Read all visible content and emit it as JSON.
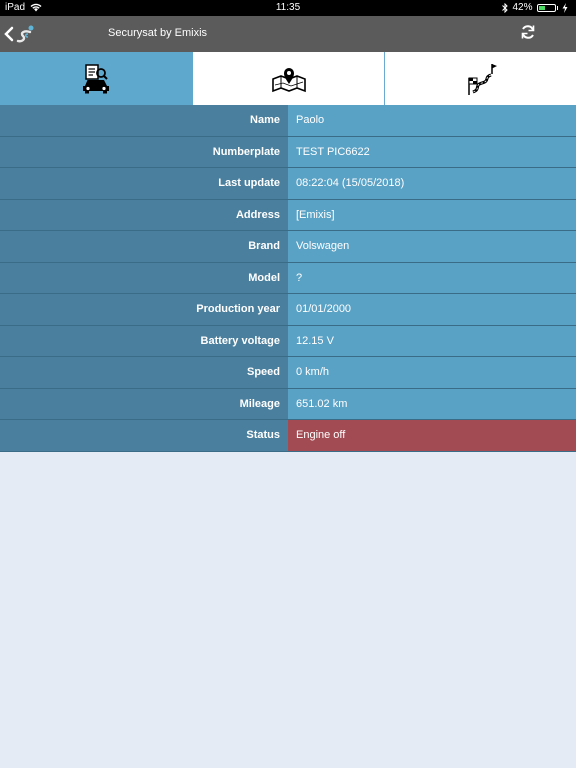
{
  "status_bar": {
    "device": "iPad",
    "time": "11:35",
    "battery_percent": "42%",
    "battery_level": 0.42,
    "icons": [
      "wifi-icon",
      "bluetooth-icon",
      "battery-icon",
      "charging-icon"
    ]
  },
  "nav": {
    "title": "Securysat by Emixis",
    "icons": [
      "back-chevron-icon",
      "app-logo-icon",
      "refresh-icon"
    ]
  },
  "tabs": [
    {
      "name": "vehicle-info",
      "icon": "car-document-icon",
      "active": true
    },
    {
      "name": "map",
      "icon": "map-pin-icon",
      "active": false
    },
    {
      "name": "route",
      "icon": "route-flag-icon",
      "active": false
    }
  ],
  "details": {
    "rows": [
      {
        "label": "Name",
        "value": "Paolo"
      },
      {
        "label": "Numberplate",
        "value": "TEST PIC6622"
      },
      {
        "label": "Last update",
        "value": "08:22:04 (15/05/2018)"
      },
      {
        "label": "Address",
        "value": "[Emixis]"
      },
      {
        "label": "Brand",
        "value": "Volswagen"
      },
      {
        "label": "Model",
        "value": "?"
      },
      {
        "label": "Production year",
        "value": "01/01/2000"
      },
      {
        "label": "Battery voltage",
        "value": "12.15 V"
      },
      {
        "label": "Speed",
        "value": "0 km/h"
      },
      {
        "label": "Mileage",
        "value": "651.02 km"
      },
      {
        "label": "Status",
        "value": "Engine off"
      }
    ]
  },
  "colors": {
    "label_bg": "#4b7f9e",
    "value_bg": "#5aa2c5",
    "status_bg": "#a24b52",
    "active_tab": "#5fa8cd",
    "navbar": "#5b5b5b"
  }
}
